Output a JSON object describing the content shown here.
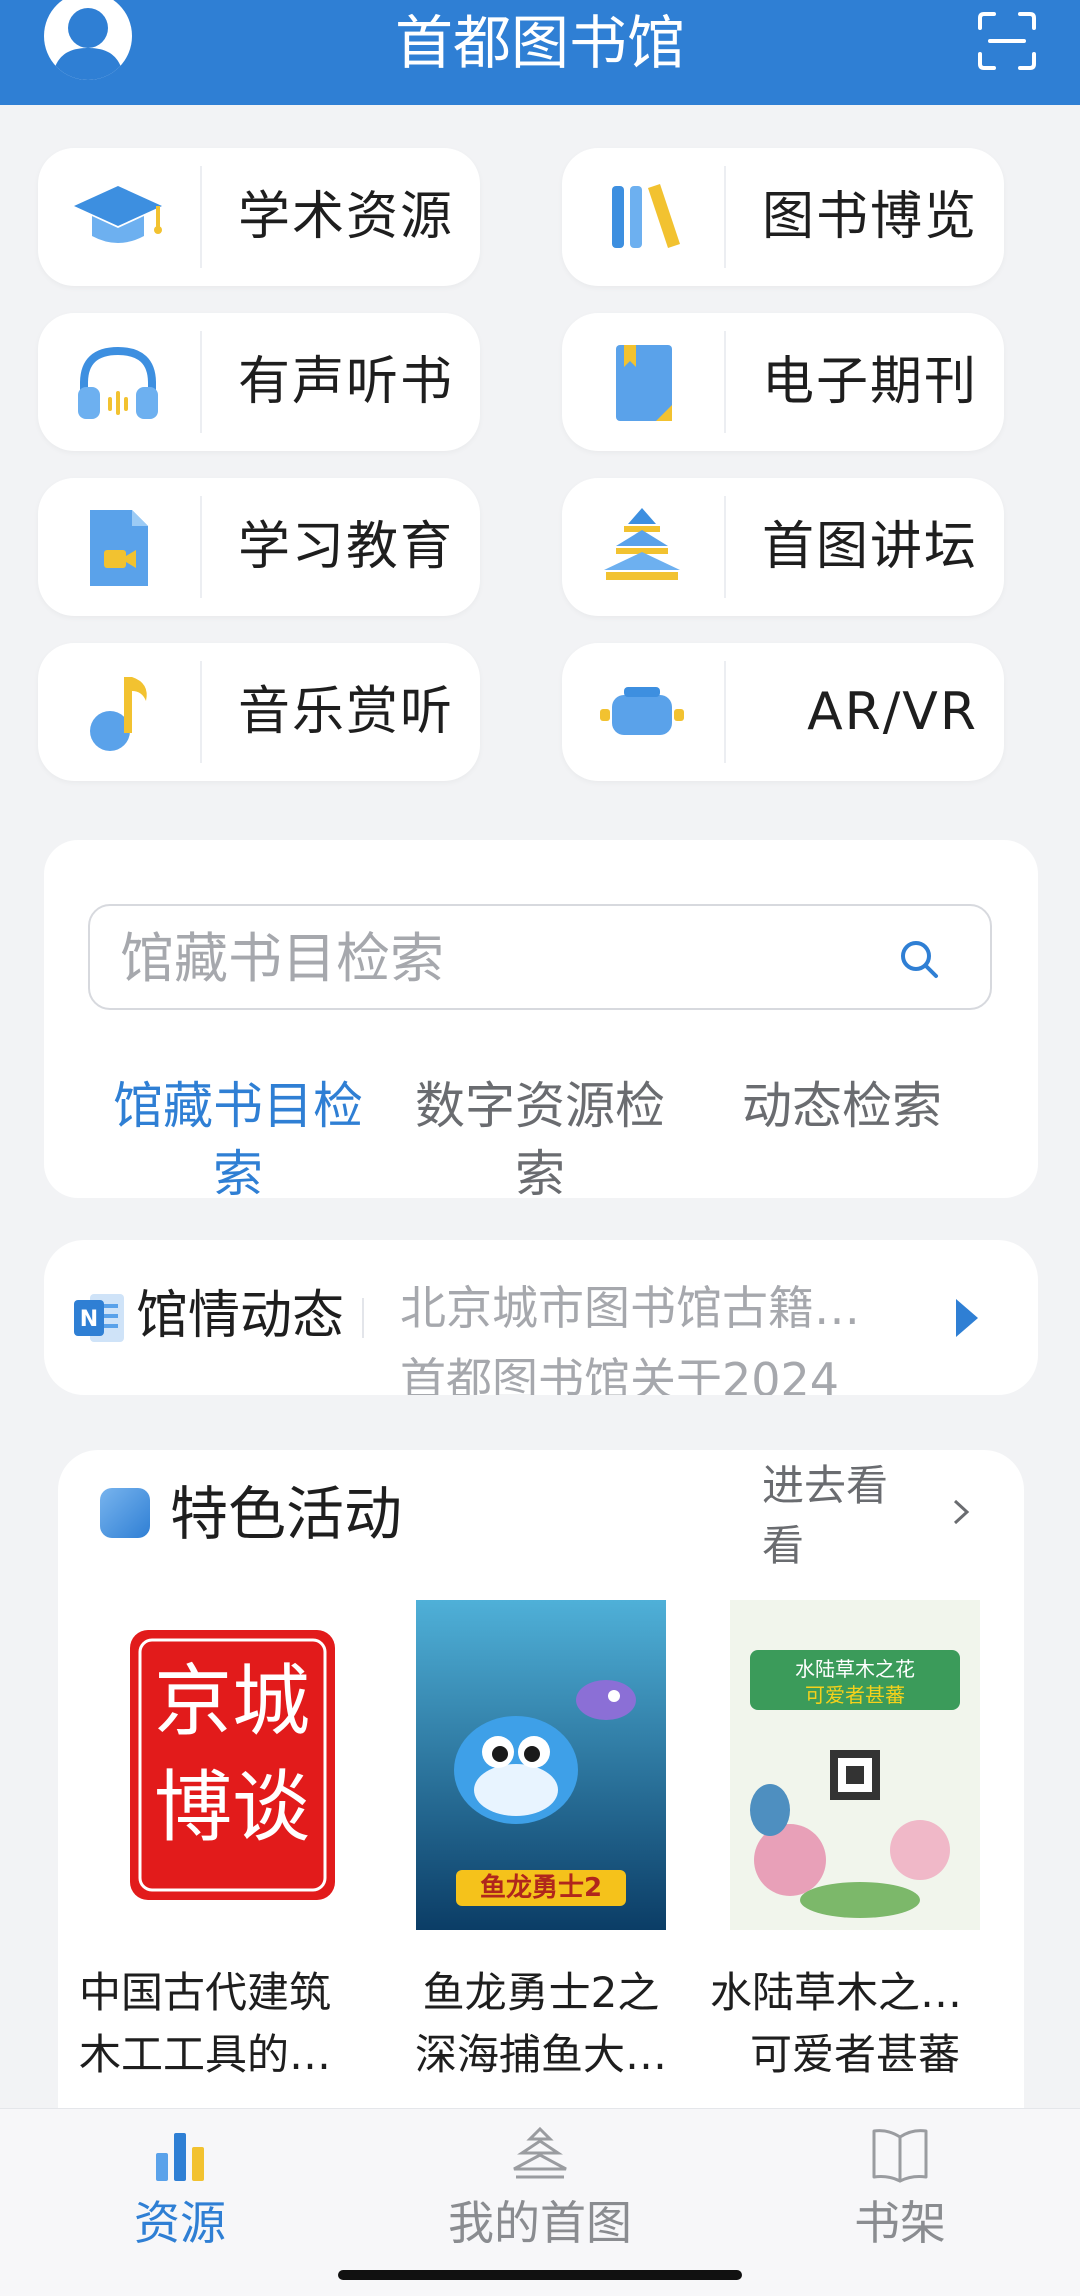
{
  "header": {
    "title": "首都图书馆"
  },
  "colors": {
    "primary": "#2f7fd4",
    "background": "#f2f3f5"
  },
  "tiles": [
    {
      "label": "学术资源",
      "icon": "graduation-cap-icon"
    },
    {
      "label": "图书博览",
      "icon": "books-icon"
    },
    {
      "label": "有声听书",
      "icon": "headphones-icon"
    },
    {
      "label": "电子期刊",
      "icon": "journal-icon"
    },
    {
      "label": "学习教育",
      "icon": "video-file-icon"
    },
    {
      "label": "首图讲坛",
      "icon": "temple-icon"
    },
    {
      "label": "音乐赏听",
      "icon": "music-note-icon"
    },
    {
      "label": "AR/VR",
      "icon": "vr-headset-icon"
    }
  ],
  "search": {
    "placeholder": "馆藏书目检索",
    "tabs": [
      {
        "line1": "馆藏书目检",
        "line2": "索"
      },
      {
        "line1": "数字资源检",
        "line2": "索"
      },
      {
        "line1": "动态检索",
        "line2": ""
      }
    ]
  },
  "news": {
    "title": "馆情动态",
    "items": [
      "北京城市图书馆古籍…",
      "首都图书馆关于2024"
    ]
  },
  "activities": {
    "title": "特色活动",
    "more_line1": "进去看",
    "more_line2": "看",
    "items": [
      {
        "poster_text": "京城博谈",
        "line1": "中国古代建筑",
        "line2": "木工工具的…"
      },
      {
        "poster_text": "鱼龙勇士2",
        "line1": "鱼龙勇士2之",
        "line2": "深海捕鱼大…"
      },
      {
        "poster_text": "水陆草木之花 可爱者甚蕃",
        "line1": "水陆草木之花，",
        "line2": "可爱者甚蕃"
      }
    ]
  },
  "tabbar": [
    {
      "label": "资源",
      "icon": "bar-chart-icon"
    },
    {
      "label": "我的首图",
      "icon": "temple-icon"
    },
    {
      "label": "书架",
      "icon": "book-icon"
    }
  ]
}
